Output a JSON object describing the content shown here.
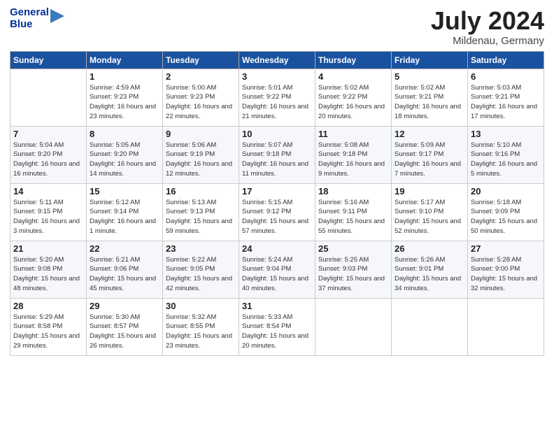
{
  "header": {
    "logo_line1": "General",
    "logo_line2": "Blue",
    "month": "July 2024",
    "location": "Mildenau, Germany"
  },
  "weekdays": [
    "Sunday",
    "Monday",
    "Tuesday",
    "Wednesday",
    "Thursday",
    "Friday",
    "Saturday"
  ],
  "weeks": [
    [
      null,
      {
        "day": 1,
        "sunrise": "Sunrise: 4:59 AM",
        "sunset": "Sunset: 9:23 PM",
        "daylight": "Daylight: 16 hours and 23 minutes."
      },
      {
        "day": 2,
        "sunrise": "Sunrise: 5:00 AM",
        "sunset": "Sunset: 9:23 PM",
        "daylight": "Daylight: 16 hours and 22 minutes."
      },
      {
        "day": 3,
        "sunrise": "Sunrise: 5:01 AM",
        "sunset": "Sunset: 9:22 PM",
        "daylight": "Daylight: 16 hours and 21 minutes."
      },
      {
        "day": 4,
        "sunrise": "Sunrise: 5:02 AM",
        "sunset": "Sunset: 9:22 PM",
        "daylight": "Daylight: 16 hours and 20 minutes."
      },
      {
        "day": 5,
        "sunrise": "Sunrise: 5:02 AM",
        "sunset": "Sunset: 9:21 PM",
        "daylight": "Daylight: 16 hours and 18 minutes."
      },
      {
        "day": 6,
        "sunrise": "Sunrise: 5:03 AM",
        "sunset": "Sunset: 9:21 PM",
        "daylight": "Daylight: 16 hours and 17 minutes."
      }
    ],
    [
      {
        "day": 7,
        "sunrise": "Sunrise: 5:04 AM",
        "sunset": "Sunset: 9:20 PM",
        "daylight": "Daylight: 16 hours and 16 minutes."
      },
      {
        "day": 8,
        "sunrise": "Sunrise: 5:05 AM",
        "sunset": "Sunset: 9:20 PM",
        "daylight": "Daylight: 16 hours and 14 minutes."
      },
      {
        "day": 9,
        "sunrise": "Sunrise: 5:06 AM",
        "sunset": "Sunset: 9:19 PM",
        "daylight": "Daylight: 16 hours and 12 minutes."
      },
      {
        "day": 10,
        "sunrise": "Sunrise: 5:07 AM",
        "sunset": "Sunset: 9:18 PM",
        "daylight": "Daylight: 16 hours and 11 minutes."
      },
      {
        "day": 11,
        "sunrise": "Sunrise: 5:08 AM",
        "sunset": "Sunset: 9:18 PM",
        "daylight": "Daylight: 16 hours and 9 minutes."
      },
      {
        "day": 12,
        "sunrise": "Sunrise: 5:09 AM",
        "sunset": "Sunset: 9:17 PM",
        "daylight": "Daylight: 16 hours and 7 minutes."
      },
      {
        "day": 13,
        "sunrise": "Sunrise: 5:10 AM",
        "sunset": "Sunset: 9:16 PM",
        "daylight": "Daylight: 16 hours and 5 minutes."
      }
    ],
    [
      {
        "day": 14,
        "sunrise": "Sunrise: 5:11 AM",
        "sunset": "Sunset: 9:15 PM",
        "daylight": "Daylight: 16 hours and 3 minutes."
      },
      {
        "day": 15,
        "sunrise": "Sunrise: 5:12 AM",
        "sunset": "Sunset: 9:14 PM",
        "daylight": "Daylight: 16 hours and 1 minute."
      },
      {
        "day": 16,
        "sunrise": "Sunrise: 5:13 AM",
        "sunset": "Sunset: 9:13 PM",
        "daylight": "Daylight: 15 hours and 59 minutes."
      },
      {
        "day": 17,
        "sunrise": "Sunrise: 5:15 AM",
        "sunset": "Sunset: 9:12 PM",
        "daylight": "Daylight: 15 hours and 57 minutes."
      },
      {
        "day": 18,
        "sunrise": "Sunrise: 5:16 AM",
        "sunset": "Sunset: 9:11 PM",
        "daylight": "Daylight: 15 hours and 55 minutes."
      },
      {
        "day": 19,
        "sunrise": "Sunrise: 5:17 AM",
        "sunset": "Sunset: 9:10 PM",
        "daylight": "Daylight: 15 hours and 52 minutes."
      },
      {
        "day": 20,
        "sunrise": "Sunrise: 5:18 AM",
        "sunset": "Sunset: 9:09 PM",
        "daylight": "Daylight: 15 hours and 50 minutes."
      }
    ],
    [
      {
        "day": 21,
        "sunrise": "Sunrise: 5:20 AM",
        "sunset": "Sunset: 9:08 PM",
        "daylight": "Daylight: 15 hours and 48 minutes."
      },
      {
        "day": 22,
        "sunrise": "Sunrise: 5:21 AM",
        "sunset": "Sunset: 9:06 PM",
        "daylight": "Daylight: 15 hours and 45 minutes."
      },
      {
        "day": 23,
        "sunrise": "Sunrise: 5:22 AM",
        "sunset": "Sunset: 9:05 PM",
        "daylight": "Daylight: 15 hours and 42 minutes."
      },
      {
        "day": 24,
        "sunrise": "Sunrise: 5:24 AM",
        "sunset": "Sunset: 9:04 PM",
        "daylight": "Daylight: 15 hours and 40 minutes."
      },
      {
        "day": 25,
        "sunrise": "Sunrise: 5:25 AM",
        "sunset": "Sunset: 9:03 PM",
        "daylight": "Daylight: 15 hours and 37 minutes."
      },
      {
        "day": 26,
        "sunrise": "Sunrise: 5:26 AM",
        "sunset": "Sunset: 9:01 PM",
        "daylight": "Daylight: 15 hours and 34 minutes."
      },
      {
        "day": 27,
        "sunrise": "Sunrise: 5:28 AM",
        "sunset": "Sunset: 9:00 PM",
        "daylight": "Daylight: 15 hours and 32 minutes."
      }
    ],
    [
      {
        "day": 28,
        "sunrise": "Sunrise: 5:29 AM",
        "sunset": "Sunset: 8:58 PM",
        "daylight": "Daylight: 15 hours and 29 minutes."
      },
      {
        "day": 29,
        "sunrise": "Sunrise: 5:30 AM",
        "sunset": "Sunset: 8:57 PM",
        "daylight": "Daylight: 15 hours and 26 minutes."
      },
      {
        "day": 30,
        "sunrise": "Sunrise: 5:32 AM",
        "sunset": "Sunset: 8:55 PM",
        "daylight": "Daylight: 15 hours and 23 minutes."
      },
      {
        "day": 31,
        "sunrise": "Sunrise: 5:33 AM",
        "sunset": "Sunset: 8:54 PM",
        "daylight": "Daylight: 15 hours and 20 minutes."
      },
      null,
      null,
      null
    ]
  ]
}
